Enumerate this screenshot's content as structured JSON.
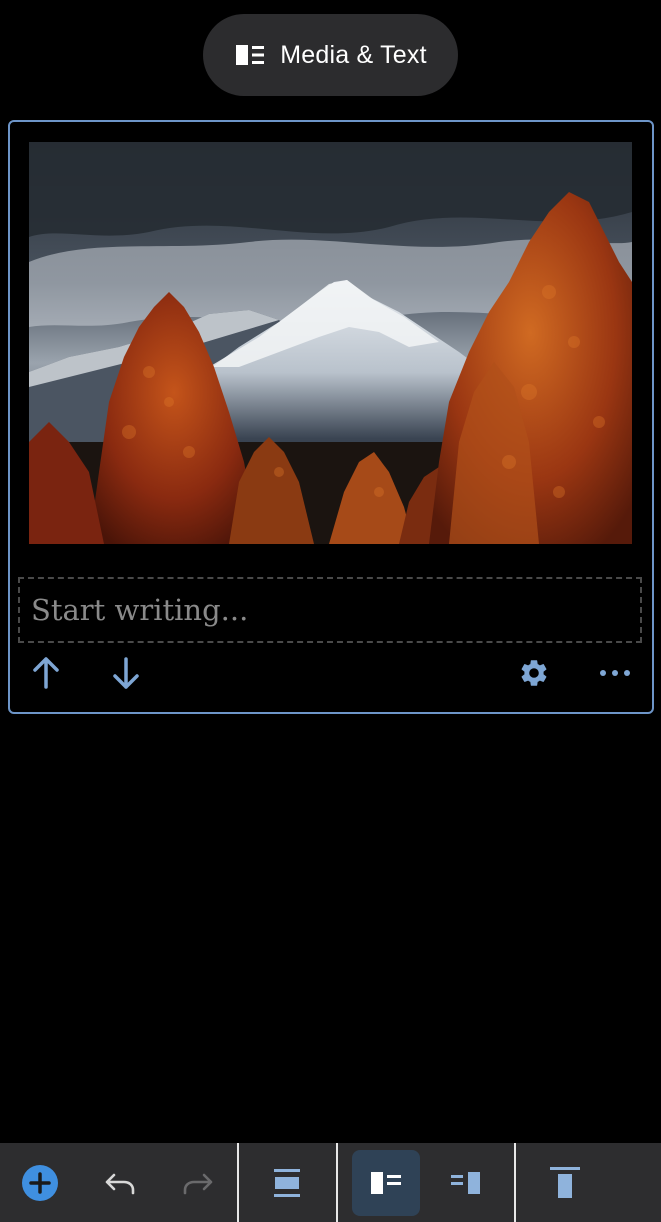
{
  "header": {
    "block_name": "Media & Text",
    "block_icon": "media-text-icon"
  },
  "block": {
    "image": {
      "alt": "Snowy mountain peak under dark clouds with autumn red trees",
      "icon": "image"
    },
    "text_placeholder": "Start writing...",
    "actions": {
      "move_up_icon": "arrow-up-icon",
      "move_down_icon": "arrow-down-icon",
      "settings_icon": "gear-icon",
      "more_icon": "more-horizontal-icon"
    }
  },
  "toolbar": {
    "items": [
      {
        "icon": "add-block-icon"
      },
      {
        "icon": "undo-icon"
      },
      {
        "icon": "redo-icon",
        "disabled": true
      },
      {
        "icon": "align-center-icon"
      },
      {
        "icon": "media-left-icon",
        "active": true
      },
      {
        "icon": "media-right-icon"
      },
      {
        "icon": "vertical-align-top-icon"
      }
    ]
  },
  "colors": {
    "background": "#000000",
    "accent_blue": "#6d95c8",
    "add_button_blue": "#3f8fe0",
    "toolbar_bg": "#2d2d2f",
    "pill_bg": "#2c2c2e",
    "active_tool_bg": "#2f4256"
  }
}
